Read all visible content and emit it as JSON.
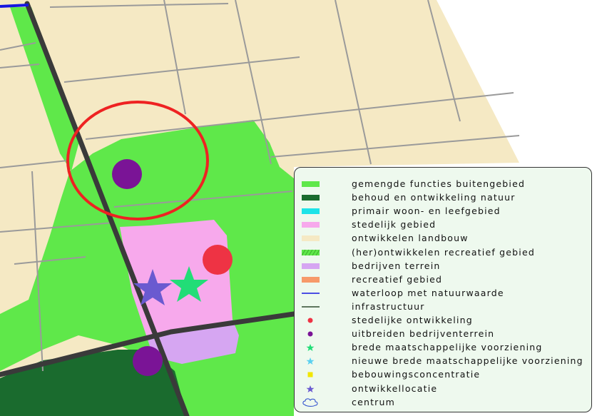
{
  "map": {
    "colors": {
      "landbouw": "#f5e9c4",
      "gemengde_functies": "#5fe84a",
      "natuur": "#1a6b2e",
      "stedelijk": "#f7a9ec",
      "bedrijven": "#d6a6f2",
      "road": "#3a3a3a",
      "secondary_road": "#9a9a9a",
      "water": "#1515e0",
      "circle": "#ee2222",
      "stedelijke_ontwikkeling": "#ee3344",
      "uitbreiden_bedrijventerrein": "#7a1496",
      "brede_voorziening": "#22dd77",
      "ontwikkellocatie": "#6a5ad0"
    }
  },
  "legend": {
    "items": [
      {
        "label": "gemengde functies buitengebied",
        "type": "swatch",
        "color": "#5fe84a",
        "icon": "swatch-icon"
      },
      {
        "label": "behoud en ontwikkeling natuur",
        "type": "swatch",
        "color": "#1a6b2e",
        "icon": "swatch-icon"
      },
      {
        "label": "primair woon- en leefgebied",
        "type": "swatch",
        "color": "#1de3e8",
        "icon": "swatch-icon"
      },
      {
        "label": "stedelijk gebied",
        "type": "swatch",
        "color": "#f7a9ec",
        "icon": "swatch-icon"
      },
      {
        "label": "ontwikkelen landbouw",
        "type": "swatch",
        "color": "#f5e9c4",
        "icon": "swatch-icon"
      },
      {
        "label": "(her)ontwikkelen recreatief gebied",
        "type": "swatch-hatch",
        "color": "#5fe84a",
        "icon": "hatched-swatch-icon"
      },
      {
        "label": "bedrijven terrein",
        "type": "swatch",
        "color": "#d6a6f2",
        "icon": "swatch-icon"
      },
      {
        "label": "recreatief gebied",
        "type": "swatch",
        "color": "#f79a6a",
        "icon": "swatch-icon"
      },
      {
        "label": "waterloop met natuurwaarde",
        "type": "line",
        "color": "#1515e0",
        "icon": "line-icon"
      },
      {
        "label": "infrastructuur",
        "type": "line",
        "color": "#2e4a2e",
        "icon": "line-icon"
      },
      {
        "label": "stedelijke ontwikkeling",
        "type": "dot",
        "color": "#ee3344",
        "icon": "dot-icon"
      },
      {
        "label": "uitbreiden bedrijventerrein",
        "type": "dot",
        "color": "#7a1496",
        "icon": "dot-icon"
      },
      {
        "label": "brede maatschappelijke voorziening",
        "type": "star",
        "color": "#22dd77",
        "icon": "star-icon"
      },
      {
        "label": "nieuwe brede maatschappelijke voorziening",
        "type": "star",
        "color": "#5ad0f0",
        "icon": "star-icon"
      },
      {
        "label": "bebouwingsconcentratie",
        "type": "square",
        "color": "#f2e600",
        "icon": "square-icon"
      },
      {
        "label": "ontwikkellocatie",
        "type": "star",
        "color": "#6a5ad0",
        "icon": "star-icon"
      },
      {
        "label": "centrum",
        "type": "cloud",
        "color": "#2244cc",
        "icon": "cloud-outline-icon"
      }
    ]
  }
}
